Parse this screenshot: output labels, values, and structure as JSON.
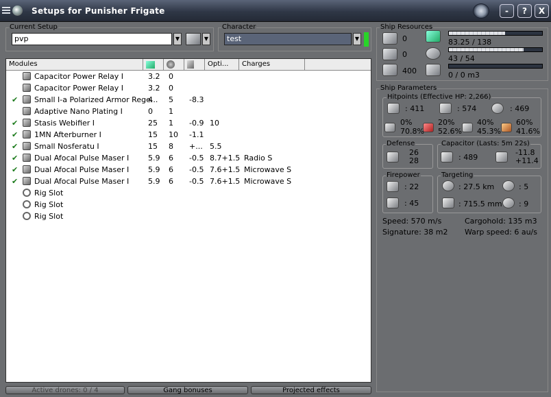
{
  "window": {
    "title": "Setups for Punisher Frigate",
    "min": "-",
    "help": "?",
    "close": "X"
  },
  "setup": {
    "label": "Current Setup",
    "value": "pvp"
  },
  "character": {
    "label": "Character",
    "value": "test",
    "status_color": "#28d428"
  },
  "modules": {
    "headers": [
      "Modules",
      "",
      "",
      "",
      "Opti...",
      "Charges"
    ],
    "rows": [
      {
        "check": "",
        "name": "Capacitor Power Relay I",
        "c1": "3.2",
        "c2": "0",
        "c3": "",
        "c4": "",
        "c5": "",
        "icon": "cap-relay-icon"
      },
      {
        "check": "",
        "name": "Capacitor Power Relay I",
        "c1": "3.2",
        "c2": "0",
        "c3": "",
        "c4": "",
        "c5": "",
        "icon": "cap-relay-icon"
      },
      {
        "check": "✔",
        "name": "Small I-a Polarized Armor Rege...",
        "c1": "4",
        "c2": "5",
        "c3": "-8.3",
        "c4": "",
        "c5": "",
        "icon": "armor-regen-icon"
      },
      {
        "check": "",
        "name": "Adaptive Nano Plating I",
        "c1": "0",
        "c2": "1",
        "c3": "",
        "c4": "",
        "c5": "",
        "icon": "nano-plating-icon"
      },
      {
        "check": "✔",
        "name": "Stasis Webifier I",
        "c1": "25",
        "c2": "1",
        "c3": "-0.9",
        "c4": "10",
        "c5": "",
        "icon": "webifier-icon"
      },
      {
        "check": "✔",
        "name": "1MN Afterburner I",
        "c1": "15",
        "c2": "10",
        "c3": "-1.1",
        "c4": "",
        "c5": "",
        "icon": "afterburner-icon"
      },
      {
        "check": "✔",
        "name": "Small Nosferatu I",
        "c1": "15",
        "c2": "8",
        "c3": "+...",
        "c4": "5.5",
        "c5": "",
        "icon": "nosferatu-icon"
      },
      {
        "check": "✔",
        "name": "Dual Afocal Pulse Maser I",
        "c1": "5.9",
        "c2": "6",
        "c3": "-0.5",
        "c4": "8.7+1.5",
        "c5": "Radio S",
        "icon": "laser-icon"
      },
      {
        "check": "✔",
        "name": "Dual Afocal Pulse Maser I",
        "c1": "5.9",
        "c2": "6",
        "c3": "-0.5",
        "c4": "7.6+1.5",
        "c5": "Microwave S",
        "icon": "laser-icon"
      },
      {
        "check": "✔",
        "name": "Dual Afocal Pulse Maser I",
        "c1": "5.9",
        "c2": "6",
        "c3": "-0.5",
        "c4": "7.6+1.5",
        "c5": "Microwave S",
        "icon": "laser-icon"
      },
      {
        "check": "",
        "name": "Rig Slot",
        "c1": "",
        "c2": "",
        "c3": "",
        "c4": "",
        "c5": "",
        "icon": "rig-slot-icon"
      },
      {
        "check": "",
        "name": "Rig Slot",
        "c1": "",
        "c2": "",
        "c3": "",
        "c4": "",
        "c5": "",
        "icon": "rig-slot-icon"
      },
      {
        "check": "",
        "name": "Rig Slot",
        "c1": "",
        "c2": "",
        "c3": "",
        "c4": "",
        "c5": "",
        "icon": "rig-slot-icon"
      }
    ]
  },
  "statusbar": {
    "drones": "Active drones: 0 / 4",
    "gang": "Gang bonuses",
    "projected": "Projected effects"
  },
  "resources": {
    "label": "Ship Resources",
    "hardpoints_turret": "0",
    "hardpoints_launcher": "0",
    "calibration": "400",
    "cpu": "83.25 / 138",
    "cpu_frac": 0.6,
    "powergrid": "43 / 54",
    "pg_frac": 0.8,
    "drone_bay": "0 / 0 m3",
    "drone_frac": 0
  },
  "params": {
    "label": "Ship Parameters",
    "hitpoints": {
      "label": "Hitpoints (Effective HP: 2,266)",
      "shield": ": 411",
      "armor": ": 574",
      "structure": ": 469",
      "res": [
        {
          "a": "0%",
          "b": "70.8%"
        },
        {
          "a": "20%",
          "b": "52.6%"
        },
        {
          "a": "40%",
          "b": "45.3%"
        },
        {
          "a": "60%",
          "b": "41.6%"
        }
      ]
    },
    "defense": {
      "label": "Defense",
      "top": "26",
      "bottom": "28"
    },
    "capacitor": {
      "label": "Capacitor (Lasts: 5m 22s)",
      "amount": ": 489",
      "top": "-11.8",
      "bottom": "+11.4"
    },
    "firepower": {
      "label": "Firepower",
      "top": ": 22",
      "bottom": ": 45"
    },
    "targeting": {
      "label": "Targeting",
      "range": ": 27.5 km",
      "targets": ": 5",
      "resolution": ": 715.5 mm",
      "scan": ": 9"
    },
    "speed": "Speed: 570 m/s",
    "cargo": "Cargohold: 135 m3",
    "signature": "Signature: 38 m2",
    "warp": "Warp speed: 6 au/s"
  }
}
